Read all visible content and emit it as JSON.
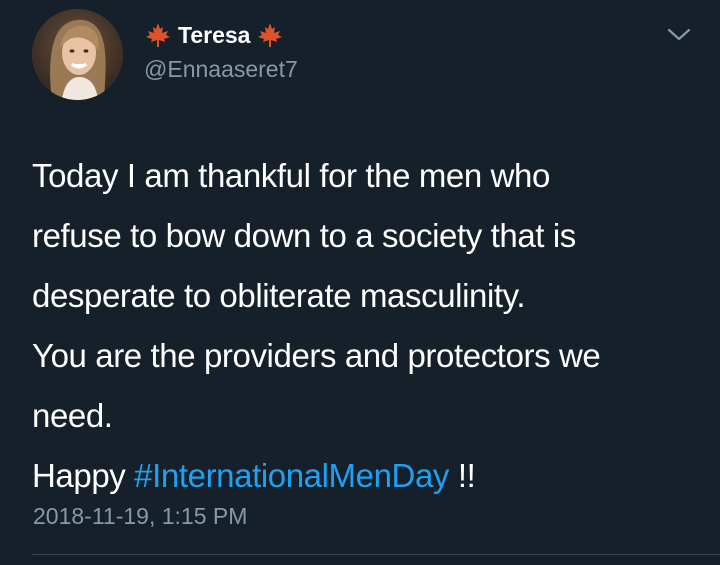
{
  "user": {
    "display_name": "Teresa",
    "handle": "@Ennaaseret7",
    "name_emoji_icon": "maple-leaf-icon"
  },
  "tweet": {
    "lines": [
      "Today I am thankful for the men who",
      "refuse to bow down to a society that is",
      "desperate to obliterate masculinity.",
      "You are the providers and protectors we",
      "need."
    ],
    "last_line_prefix": "Happy ",
    "hashtag": "#InternationalMenDay",
    "last_line_suffix": " !!",
    "timestamp": "2018-11-19, 1:15 PM"
  },
  "colors": {
    "background": "#15202b",
    "text": "#ffffff",
    "secondary": "#8899a6",
    "link": "#1da1f2",
    "divider": "#38444d"
  }
}
